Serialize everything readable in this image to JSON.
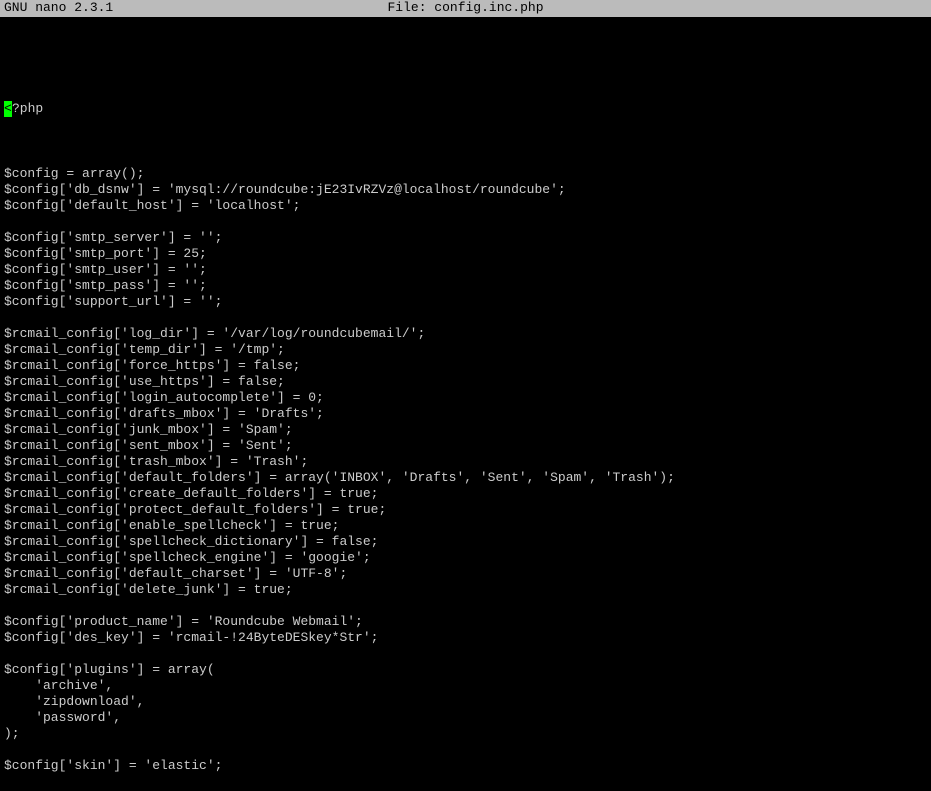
{
  "titlebar": {
    "app": "  GNU nano  2.3.1",
    "file_label": "File: config.inc.php"
  },
  "cursor_char": "<",
  "cursor_rest": "?php",
  "lines": [
    "",
    "$config = array();",
    "$config['db_dsnw'] = 'mysql://roundcube:jE23IvRZVz@localhost/roundcube';",
    "$config['default_host'] = 'localhost';",
    "",
    "$config['smtp_server'] = '';",
    "$config['smtp_port'] = 25;",
    "$config['smtp_user'] = '';",
    "$config['smtp_pass'] = '';",
    "$config['support_url'] = '';",
    "",
    "$rcmail_config['log_dir'] = '/var/log/roundcubemail/';",
    "$rcmail_config['temp_dir'] = '/tmp';",
    "$rcmail_config['force_https'] = false;",
    "$rcmail_config['use_https'] = false;",
    "$rcmail_config['login_autocomplete'] = 0;",
    "$rcmail_config['drafts_mbox'] = 'Drafts';",
    "$rcmail_config['junk_mbox'] = 'Spam';",
    "$rcmail_config['sent_mbox'] = 'Sent';",
    "$rcmail_config['trash_mbox'] = 'Trash';",
    "$rcmail_config['default_folders'] = array('INBOX', 'Drafts', 'Sent', 'Spam', 'Trash');",
    "$rcmail_config['create_default_folders'] = true;",
    "$rcmail_config['protect_default_folders'] = true;",
    "$rcmail_config['enable_spellcheck'] = true;",
    "$rcmail_config['spellcheck_dictionary'] = false;",
    "$rcmail_config['spellcheck_engine'] = 'googie';",
    "$rcmail_config['default_charset'] = 'UTF-8';",
    "$rcmail_config['delete_junk'] = true;",
    "",
    "$config['product_name'] = 'Roundcube Webmail';",
    "$config['des_key'] = 'rcmail-!24ByteDESkey*Str';",
    "",
    "$config['plugins'] = array(",
    "    'archive',",
    "    'zipdownload',",
    "    'password',",
    ");",
    "",
    "$config['skin'] = 'elastic';"
  ]
}
